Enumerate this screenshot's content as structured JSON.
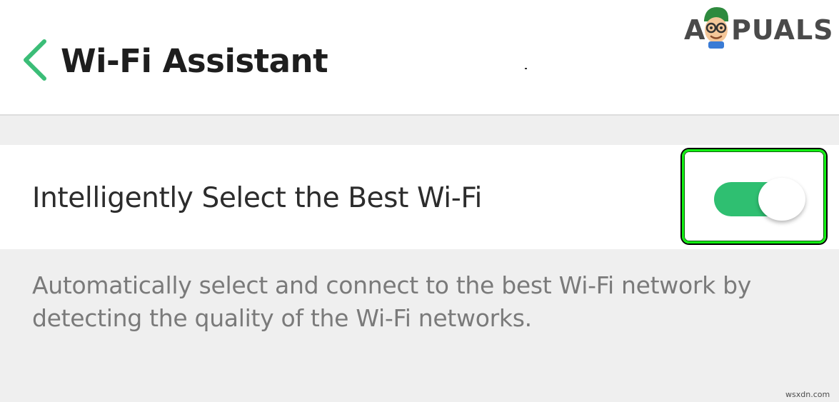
{
  "header": {
    "back_icon": "chevron-left-icon",
    "title": "Wi-Fi Assistant"
  },
  "watermark": {
    "text_before_logo": "A",
    "text_after_logo": "PUALS",
    "logo_icon": "appuals-mascot-icon"
  },
  "setting": {
    "label": "Intelligently Select the Best Wi-Fi",
    "toggle_state": "on",
    "toggle_color": "#2fbf71",
    "highlight_color": "#12ef12",
    "description": "Automatically select and connect to the best Wi-Fi network by detecting the quality of the Wi-Fi networks."
  },
  "footer": {
    "source": "wsxdn.com"
  },
  "colors": {
    "accent": "#2fbf71",
    "back_icon": "#3bbd77",
    "background": "#efefef"
  }
}
